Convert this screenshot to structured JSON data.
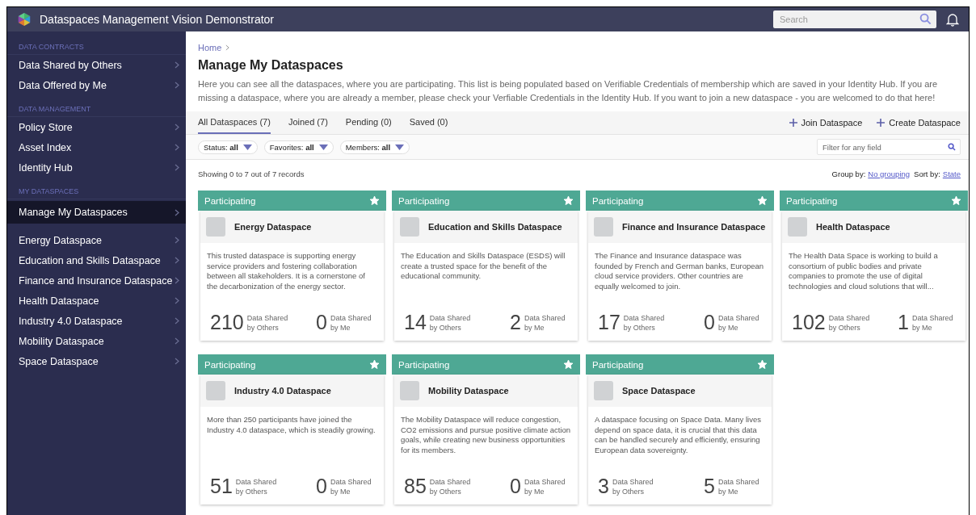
{
  "app": {
    "title": "Dataspaces Management Vision Demonstrator",
    "search_placeholder": "Search"
  },
  "sidebar": {
    "sections": [
      {
        "heading": "DATA CONTRACTS",
        "items": [
          {
            "label": "Data Shared by Others",
            "selected": false
          },
          {
            "label": "Data Offered by Me",
            "selected": false
          }
        ]
      },
      {
        "heading": "DATA MANAGEMENT",
        "items": [
          {
            "label": "Policy Store",
            "selected": false
          },
          {
            "label": "Asset Index",
            "selected": false
          },
          {
            "label": "Identity Hub",
            "selected": false
          }
        ]
      },
      {
        "heading": "MY DATASPACES",
        "items": [
          {
            "label": "Manage My Dataspaces",
            "selected": true
          }
        ]
      },
      {
        "items": [
          {
            "label": "Energy Dataspace",
            "selected": false
          },
          {
            "label": "Education and Skills Dataspace",
            "selected": false
          },
          {
            "label": "Finance and Insurance Dataspace",
            "selected": false
          },
          {
            "label": "Health Dataspace",
            "selected": false
          },
          {
            "label": "Industry 4.0 Dataspace",
            "selected": false
          },
          {
            "label": "Mobility Dataspace",
            "selected": false
          },
          {
            "label": "Space Dataspace",
            "selected": false
          }
        ]
      }
    ]
  },
  "breadcrumb": "Home",
  "page_title": "Manage My Dataspaces",
  "description": "Here you can see all the dataspaces, where you are participating. This list is being populated based on Verifiable Credentials of membership which are saved in your Identity Hub. If you are missing a dataspace, where you are already a member, please check your Verfiable Credentials in the Identity Hub. If you want to join a new dataspace - you are welcomed to do that here!",
  "tabs": [
    {
      "label": "All Dataspaces (7)",
      "selected": true
    },
    {
      "label": "Joined (7)",
      "selected": false
    },
    {
      "label": "Pending (0)",
      "selected": false
    },
    {
      "label": "Saved (0)",
      "selected": false
    }
  ],
  "actions": [
    "Join Dataspace",
    "Create Dataspace"
  ],
  "filters": [
    "Status: **all**",
    "Favorites: **all**",
    "Members: **all**"
  ],
  "filter_placeholder": "Filter for any field",
  "records": "Showing 0 to 7 out of 7 records",
  "group_by": {
    "label": "Group by:",
    "value": "No grouping"
  },
  "sort_by": {
    "label": "Sort by:",
    "value": "State"
  },
  "cards": [
    {
      "status": "Participating",
      "favorite": true,
      "title": "Energy Dataspace",
      "description": "This trusted dataspace is supporting energy service providers and fostering collaboration between all stakeholders. It is a cornerstone of the decarbonization of the energy sector.",
      "stats": [
        {
          "value": "210",
          "label": "Data Shared by Others"
        },
        {
          "value": "0",
          "label": "Data Shared by Me"
        }
      ]
    },
    {
      "status": "Participating",
      "favorite": true,
      "title": "Education and Skills Dataspace",
      "description": "The Education and Skills Dataspace (ESDS) will create a trusted space for the benefit of the educational community.",
      "stats": [
        {
          "value": "14",
          "label": "Data Shared by Others"
        },
        {
          "value": "2",
          "label": "Data Shared by Me"
        }
      ]
    },
    {
      "status": "Participating",
      "favorite": true,
      "title": "Finance and Insurance Dataspace",
      "description": "The Finance and Insurance dataspace was founded by French and German banks, European cloud service providers. Other countries are equally welcomed to join.",
      "stats": [
        {
          "value": "17",
          "label": "Data Shared by Others"
        },
        {
          "value": "0",
          "label": "Data Shared by Me"
        }
      ]
    },
    {
      "status": "Participating",
      "favorite": true,
      "title": "Health Dataspace",
      "description": "The Health Data Space is working to build a consortium of public bodies and private companies to promote the use of digital technologies and cloud solutions that will...",
      "stats": [
        {
          "value": "102",
          "label": "Data Shared by Others"
        },
        {
          "value": "1",
          "label": "Data Shared by Me"
        }
      ]
    },
    {
      "status": "Participating",
      "favorite": true,
      "title": "Industry 4.0 Dataspace",
      "description": "More than 250 participants have joined the Industry 4.0 dataspace, which is steadily growing.",
      "stats": [
        {
          "value": "51",
          "label": "Data Shared by Others"
        },
        {
          "value": "0",
          "label": "Data Shared by Me"
        }
      ]
    },
    {
      "status": "Participating",
      "favorite": true,
      "title": "Mobility Dataspace",
      "description": "The Mobility Dataspace will reduce congestion, CO2 emissions and pursue positive climate action goals, while creating new business opportunities for its members.",
      "stats": [
        {
          "value": "85",
          "label": "Data Shared by Others"
        },
        {
          "value": "0",
          "label": "Data Shared by Me"
        }
      ]
    },
    {
      "status": "Participating",
      "favorite": true,
      "title": "Space Dataspace",
      "description": "A dataspace focusing on Space Data. Many lives depend on space data, it is crucial that this data can be handled securely and efficiently, ensuring European data sovereignty.",
      "stats": [
        {
          "value": "3",
          "label": "Data Shared by Others"
        },
        {
          "value": "5",
          "label": "Data Shared by Me"
        }
      ]
    }
  ]
}
